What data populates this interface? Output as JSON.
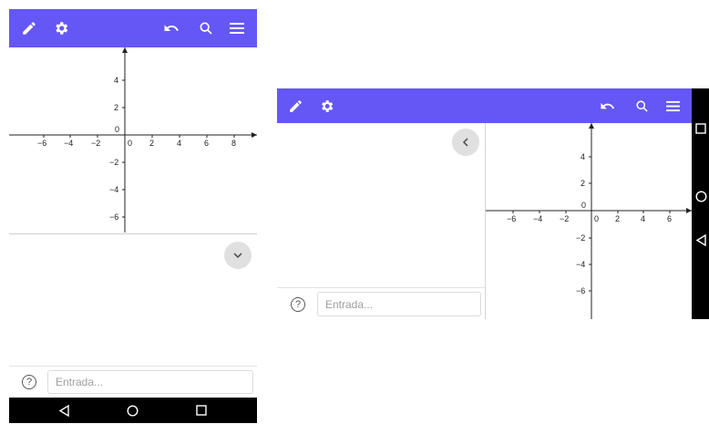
{
  "colors": {
    "toolbar": "#6557f5",
    "navbar": "#000000",
    "axis": "#222222"
  },
  "toolbar_icons": [
    "pencil-icon",
    "gear-icon",
    "undo-icon",
    "search-icon",
    "menu-icon"
  ],
  "graph_ticks": {
    "portrait_x": [
      "−6",
      "−4",
      "−2",
      "0",
      "2",
      "4",
      "6",
      "8"
    ],
    "portrait_y": [
      "4",
      "2",
      "−2",
      "−4",
      "−6"
    ],
    "landscape_x": [
      "−6",
      "−4",
      "−2",
      "0",
      "2",
      "4",
      "6"
    ],
    "landscape_y": [
      "4",
      "2",
      "−2",
      "−4",
      "−6"
    ]
  },
  "input": {
    "help_glyph": "?",
    "placeholder": "Entrada..."
  },
  "algebra_toggle": {
    "portrait_icon": "chevron-down-icon",
    "landscape_icon": "chevron-left-icon"
  },
  "nav_icons": [
    "back-icon",
    "home-icon",
    "recents-icon"
  ]
}
